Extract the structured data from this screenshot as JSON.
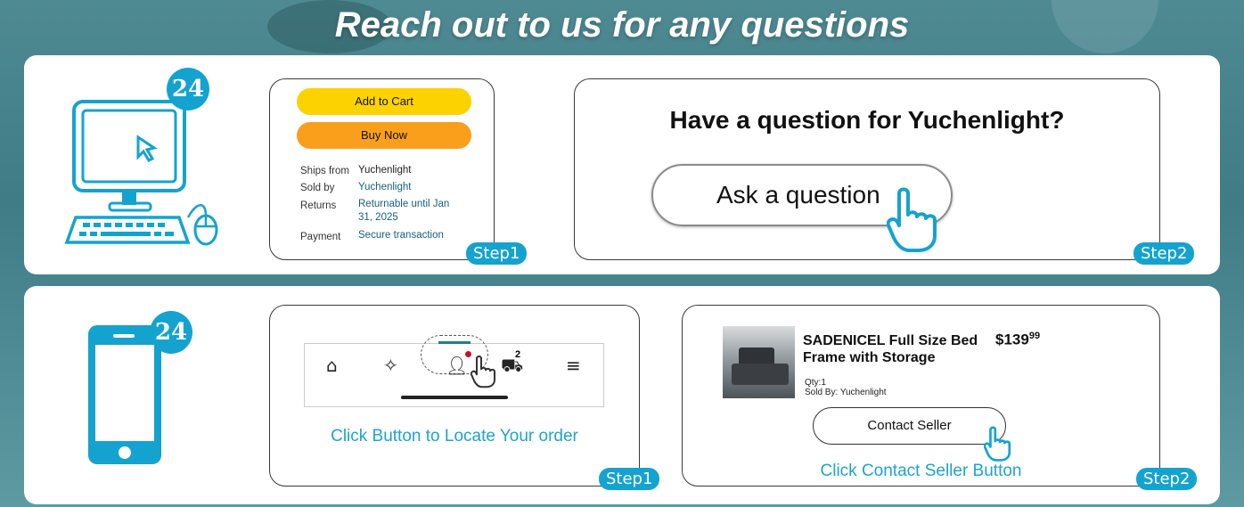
{
  "headline": "Reach out to us for any questions",
  "badge_number": "24",
  "colors": {
    "accent": "#14a3cf",
    "yellow": "#fcd200",
    "orange": "#fa9f1b",
    "link": "#16607a"
  },
  "desktop_flow": {
    "step1": {
      "add_to_cart": "Add to Cart",
      "buy_now": "Buy Now",
      "rows": [
        {
          "label": "Ships from",
          "value": "Yuchenlight"
        },
        {
          "label": "Sold by",
          "value": "Yuchenlight"
        },
        {
          "label": "Returns",
          "value_line1": "Returnable until Jan",
          "value_line2": "31, 2025"
        },
        {
          "label": "Payment",
          "value": "Secure transaction"
        }
      ],
      "badge": "Step1"
    },
    "step2": {
      "title": "Have a question for Yuchenlight?",
      "button": "Ask a question",
      "badge": "Step2"
    }
  },
  "mobile_flow": {
    "step1": {
      "nav_icons": [
        "home-icon",
        "sparkle-icon",
        "account-icon",
        "cart-icon",
        "menu-icon"
      ],
      "cart_count": "2",
      "caption": "Click Button to Locate Your order",
      "badge": "Step1"
    },
    "step2": {
      "product_title": "SADENICEL Full Size Bed Frame with Storage",
      "price_whole": "$139",
      "price_cents": "99",
      "qty": "Qty:1",
      "sold_by": "Sold By: Yuchenlight",
      "button": "Contact Seller",
      "caption": "Click Contact Seller Button",
      "badge": "Step2"
    }
  }
}
